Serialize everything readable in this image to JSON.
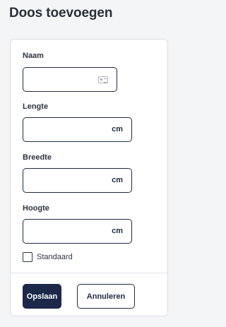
{
  "page": {
    "title": "Doos toevoegen"
  },
  "form": {
    "fields": [
      {
        "label": "Naam",
        "value": "",
        "icon": "contact-card-icon"
      },
      {
        "label": "Lengte",
        "value": "",
        "suffix": "cm"
      },
      {
        "label": "Breedte",
        "value": "",
        "suffix": "cm"
      },
      {
        "label": "Hoogte",
        "value": "",
        "suffix": "cm"
      }
    ],
    "default_checkbox": {
      "label": "Standaard",
      "checked": false
    }
  },
  "actions": {
    "save_label": "Opslaan",
    "cancel_label": "Annuleren"
  },
  "colors": {
    "primary": "#1b2849",
    "border": "#1f2a44",
    "background": "#f4f5f7"
  }
}
